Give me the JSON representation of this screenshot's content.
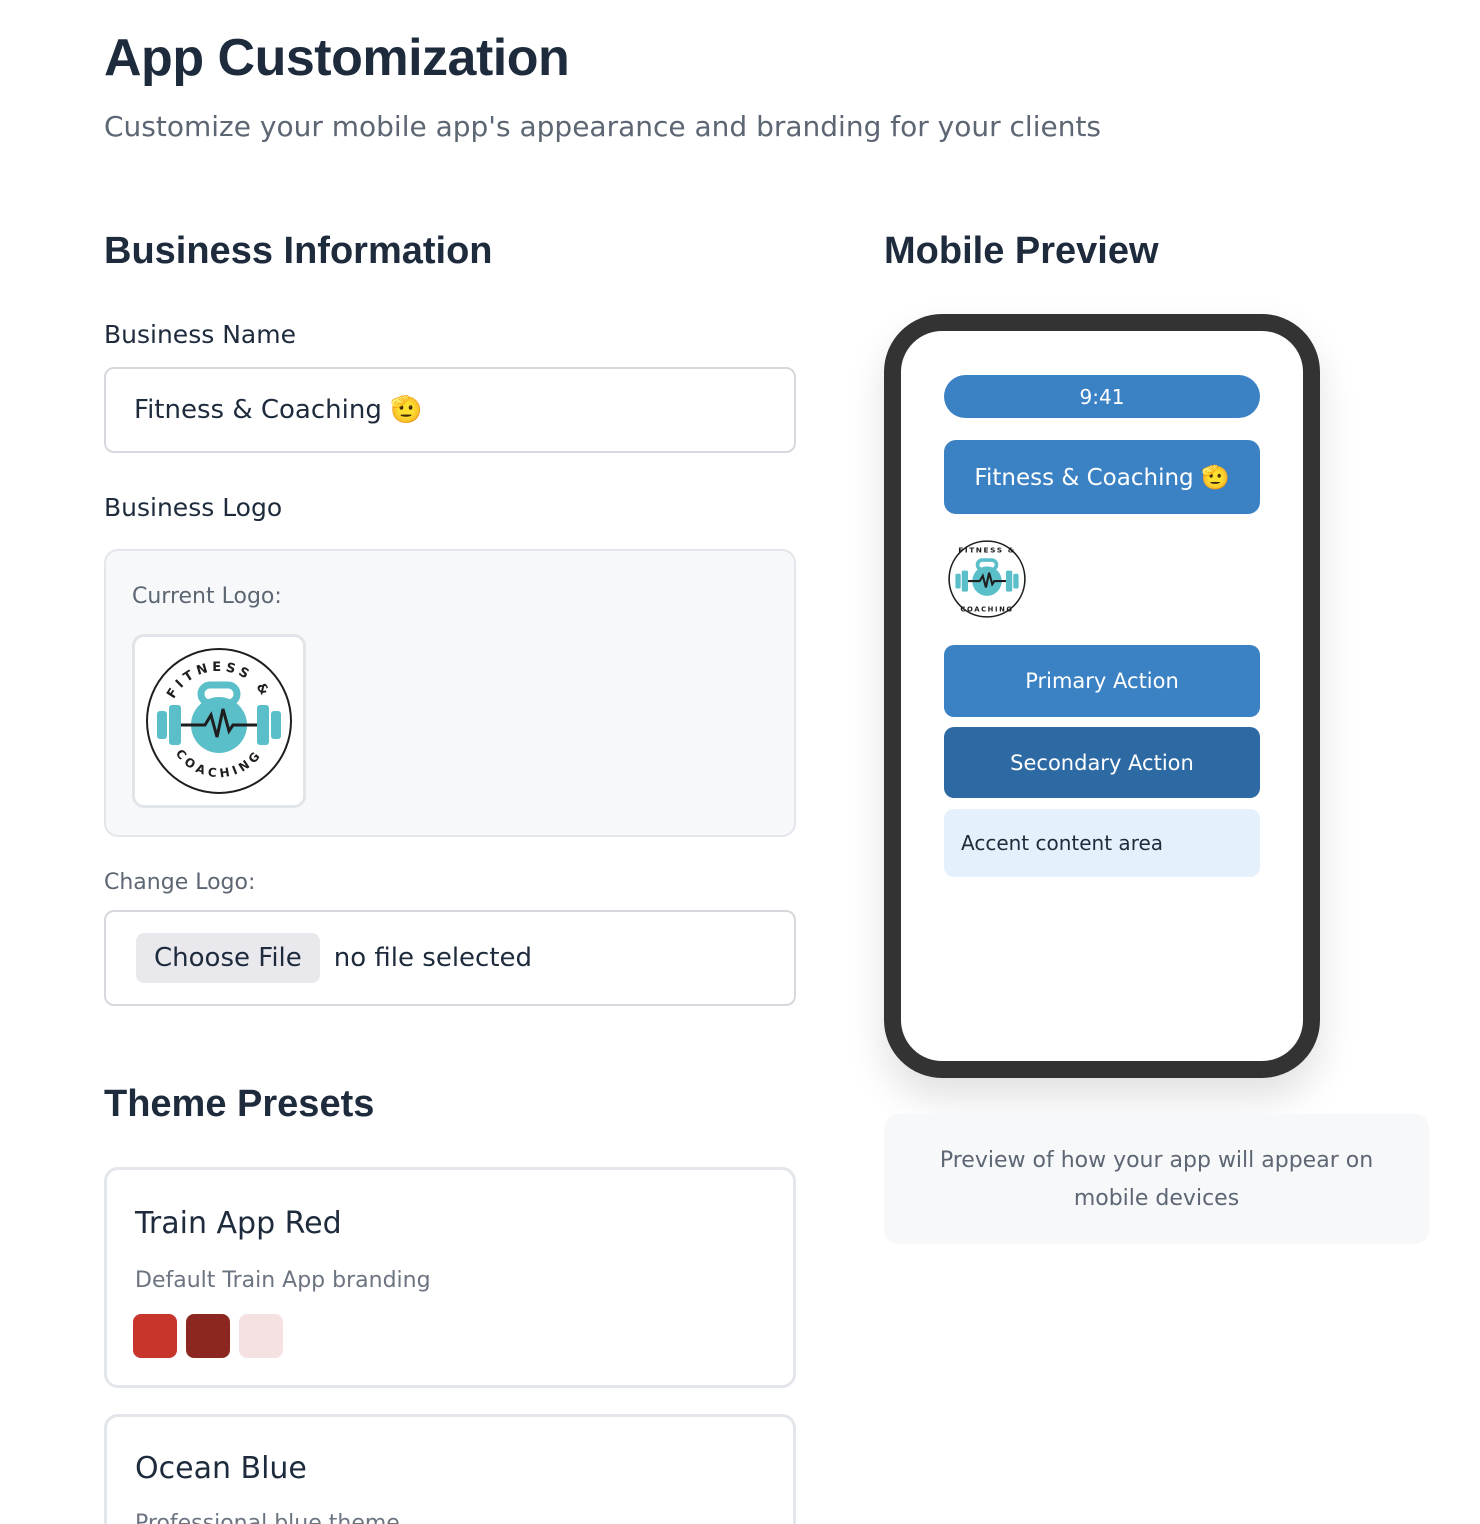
{
  "header": {
    "title": "App Customization",
    "subtitle": "Customize your mobile app's appearance and branding for your clients"
  },
  "business": {
    "section_title": "Business Information",
    "name_label": "Business Name",
    "name_value": "Fitness & Coaching 🫡",
    "logo_label": "Business Logo",
    "current_logo_label": "Current Logo:",
    "change_logo_label": "Change Logo:",
    "choose_file_button": "Choose File",
    "file_status": "no file selected",
    "logo_text_top": "FITNESS &",
    "logo_text_bottom": "COACHING"
  },
  "themes": {
    "section_title": "Theme Presets",
    "presets": [
      {
        "name": "Train App Red",
        "description": "Default Train App branding",
        "colors": [
          "#c8352b",
          "#8b2621",
          "#f5e1e2"
        ]
      },
      {
        "name": "Ocean Blue",
        "description": "Professional blue theme",
        "colors": []
      }
    ]
  },
  "preview": {
    "section_title": "Mobile Preview",
    "status_time": "9:41",
    "app_header": "Fitness & Coaching 🫡",
    "primary_action": "Primary Action",
    "secondary_action": "Secondary Action",
    "accent_text": "Accent content area",
    "note": "Preview of how your app will appear on mobile devices",
    "colors": {
      "primary": "#3b82c4",
      "secondary": "#2d6aa4",
      "accent": "#e4f0fb"
    }
  },
  "logo_colors": {
    "kettlebell": "#5bbfca",
    "ring": "#1e1e1e"
  }
}
